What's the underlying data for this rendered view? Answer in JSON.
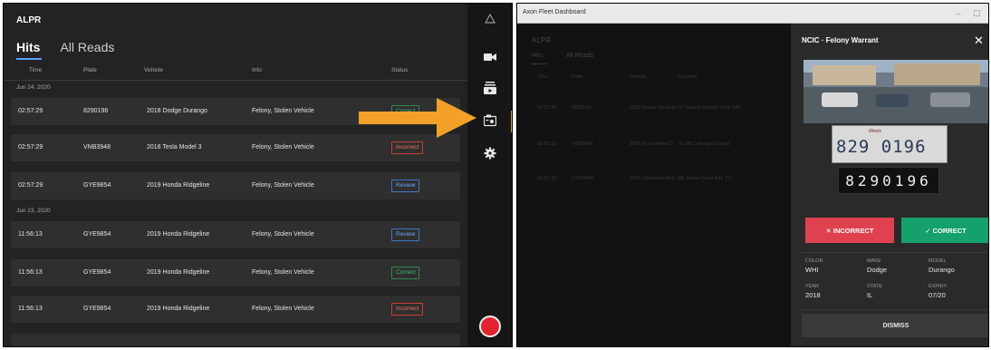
{
  "left_app": {
    "title": "ALPR",
    "tabs": [
      {
        "label": "Hits"
      },
      {
        "label": "All Reads"
      }
    ],
    "columns": {
      "time": "Time",
      "plate": "Plate",
      "vehicle": "Vehicle",
      "info": "Info",
      "status": "Status"
    },
    "groups": [
      {
        "date": "Jun 24, 2020",
        "rows": [
          {
            "time": "02:57:29",
            "plate": "8290196",
            "vehicle": "2018 Dodge Durango",
            "info": "Felony, Stolen Vehicle",
            "status": "Correct"
          },
          {
            "time": "02:57:29",
            "plate": "VNB3948",
            "vehicle": "2018 Tesla Model 3",
            "info": "Felony, Stolen Vehicle",
            "status": "Incorrect"
          },
          {
            "time": "02:57:29",
            "plate": "GYE9854",
            "vehicle": "2019 Honda Ridgeline",
            "info": "Felony, Stolen Vehicle",
            "status": "Review"
          }
        ]
      },
      {
        "date": "Jun 23, 2020",
        "rows": [
          {
            "time": "11:56:13",
            "plate": "GYE9854",
            "vehicle": "2019 Honda Ridgeline",
            "info": "Felony, Stolen Vehicle",
            "status": "Review"
          },
          {
            "time": "11:56:13",
            "plate": "GYE9854",
            "vehicle": "2019 Honda Ridgeline",
            "info": "Felony, Stolen Vehicle",
            "status": "Correct"
          },
          {
            "time": "11:56:13",
            "plate": "GYE9854",
            "vehicle": "2019 Honda Ridgeline",
            "info": "Felony, Stolen Vehicle",
            "status": "Incorrect"
          }
        ]
      }
    ],
    "rail_icons": [
      "warning-icon",
      "video-camera-icon",
      "media-stack-icon",
      "camera-card-icon",
      "settings-gear-icon",
      "record-button"
    ],
    "colors": {
      "accent": "#f2a028",
      "record": "#e2242f",
      "correct": "#39c06a",
      "incorrect": "#ff6a6a",
      "review": "#6aa8ff"
    }
  },
  "right_app": {
    "window_title": "Axon Fleet Dashboard",
    "window_controls": {
      "minimize": "–",
      "maximize": "☐"
    },
    "background": {
      "title": "ALPR",
      "tabs": [
        "Hits",
        "All Reads"
      ],
      "columns": {
        "time": "Time",
        "plate": "Plate",
        "vehicle": "Vehicle",
        "location": "Location"
      },
      "rows": [
        {
          "time": "02:57:29",
          "plate": "8290196",
          "vehicle": "2018 Dodge Durango",
          "location": "67 Nasoni Branch Suite 129"
        },
        {
          "time": "02:57:29",
          "plate": "VNB3948",
          "vehicle": "2018 Tesla Model 3",
          "location": "76 McCullough Estates"
        },
        {
          "time": "02:57:29",
          "plate": "GYE9854",
          "vehicle": "2006 Chevrolet Mali...",
          "location": "86 Joanie Crest Apt. 771"
        }
      ]
    },
    "panel": {
      "title": "NCIC · Felony Warrant",
      "close": "✕",
      "plate_photo_text": "829 0196",
      "plate_state_text": "Illinois",
      "ocr_plate": "8290196",
      "incorrect_label": "✕  INCORRECT",
      "correct_label": "✓  CORRECT",
      "details": [
        {
          "label": "COLOR",
          "value": "WHI"
        },
        {
          "label": "MAKE",
          "value": "Dodge"
        },
        {
          "label": "MODEL",
          "value": "Durango"
        },
        {
          "label": "YEAR",
          "value": "2018"
        },
        {
          "label": "STATE",
          "value": "IL"
        },
        {
          "label": "EXPIRY",
          "value": "07/20"
        }
      ],
      "dismiss_label": "DISMISS"
    },
    "colors": {
      "incorrect": "#e0414f",
      "correct": "#15a06c"
    }
  },
  "annotation": {
    "arrow_color": "#f2a028"
  }
}
